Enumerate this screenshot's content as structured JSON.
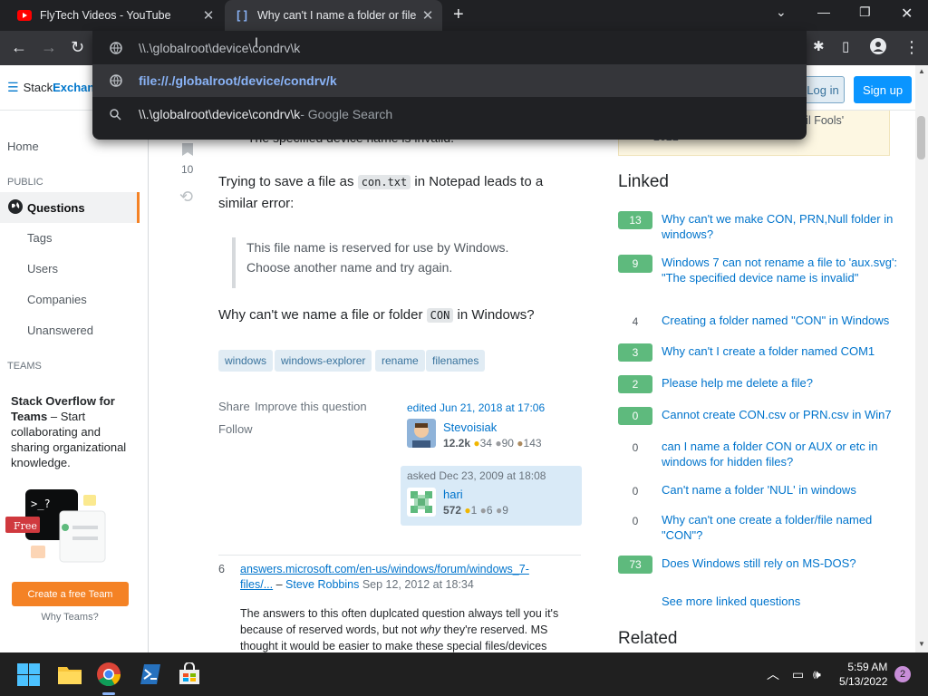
{
  "browser": {
    "tabs": [
      {
        "title": "FlyTech Videos - YouTube",
        "active": false
      },
      {
        "title": "Why can't I name a folder or file",
        "active": true
      }
    ],
    "new_tab": "+",
    "omnibox": {
      "typed": "\\\\.\\globalroot\\device\\condrv\\k",
      "suggestions": [
        {
          "text": "file://./globalroot/device/condrv/k",
          "suffix": ""
        },
        {
          "text": "\\\\.\\globalroot\\device\\condrv\\k",
          "suffix": " - Google Search"
        }
      ]
    }
  },
  "header": {
    "logo_a": "Stack",
    "logo_b": "Exchan",
    "login": "Log in",
    "signup": "Sign up"
  },
  "nav": {
    "home": "Home",
    "public": "PUBLIC",
    "questions": "Questions",
    "tags": "Tags",
    "users": "Users",
    "companies": "Companies",
    "unanswered": "Unanswered",
    "teams_section": "TEAMS",
    "teams_title": "Stack Overflow for Teams",
    "teams_desc": " – Start collaborating and sharing organizational knowledge.",
    "free_badge": "Free",
    "create_team": "Create a free Team",
    "why_teams": "Why Teams?"
  },
  "post": {
    "partial_line": "The specified device name is invalid.",
    "vote_count": "10",
    "p1_before": "Trying to save a file as ",
    "p1_code": "con.txt",
    "p1_after": " in Notepad leads to a similar error:",
    "quote": "This file name is reserved for use by Windows. Choose another name and try again.",
    "p2_before": "Why can't we name a file or folder ",
    "p2_code": "CON",
    "p2_after": " in Windows?",
    "tags": [
      "windows",
      "windows-explorer",
      "rename",
      "filenames"
    ],
    "share": "Share",
    "improve": "Improve this question",
    "follow": "Follow",
    "edited": "edited Jun 21, 2018 at 17:06",
    "editor": {
      "name": "Stevoisiak",
      "rep": "12.2k",
      "gold": "34",
      "silver": "90",
      "bronze": "143"
    },
    "asked": "asked Dec 23, 2009 at 18:08",
    "asker": {
      "name": "hari",
      "rep": "572",
      "gold": "1",
      "silver": "6",
      "bronze": "9"
    }
  },
  "comment": {
    "score": "6",
    "link": "answers.microsoft.com/en-us/windows/forum/windows_7-files/...",
    "dash": " – ",
    "author": "Steve Robbins",
    "date": " Sep 12, 2012 at 18:34",
    "body_1": "The answers to this often duplcated question always tell you it's because of reserved words, but not ",
    "body_em": "why",
    "body_2": " they're reserved. MS thought it would be easier to make these special files/devices"
  },
  "sidebar": {
    "yellow_a": "ril Fools'",
    "yellow_b": "2022",
    "linked_title": "Linked",
    "linked": [
      {
        "score": "13",
        "accepted": true,
        "title": "Why can't we make CON, PRN,Null folder in windows?"
      },
      {
        "score": "9",
        "accepted": true,
        "title": "Windows 7 can not rename a file to 'aux.svg': \"The specified device name is invalid\""
      },
      {
        "score": "4",
        "accepted": false,
        "title": "Creating a folder named \"CON\" in Windows"
      },
      {
        "score": "3",
        "accepted": true,
        "title": "Why can't I create a folder named COM1"
      },
      {
        "score": "2",
        "accepted": true,
        "title": "Please help me delete a file?"
      },
      {
        "score": "0",
        "accepted": true,
        "title": "Cannot create CON.csv or PRN.csv in Win7"
      },
      {
        "score": "0",
        "accepted": false,
        "title": "can I name a folder CON or AUX or etc in windows for hidden files?"
      },
      {
        "score": "0",
        "accepted": false,
        "title": "Can't name a folder 'NUL' in windows"
      },
      {
        "score": "0",
        "accepted": false,
        "title": "Why can't one create a folder/file named \"CON\"?"
      },
      {
        "score": "73",
        "accepted": true,
        "title": "Does Windows still rely on MS-DOS?"
      }
    ],
    "see_more": "See more linked questions",
    "related_title": "Related"
  },
  "taskbar": {
    "time": "5:59 AM",
    "date": "5/13/2022",
    "notifications": "2"
  },
  "colors": {
    "accent": "#0a95ff",
    "orange": "#f48225",
    "accepted": "#5eba7d"
  }
}
